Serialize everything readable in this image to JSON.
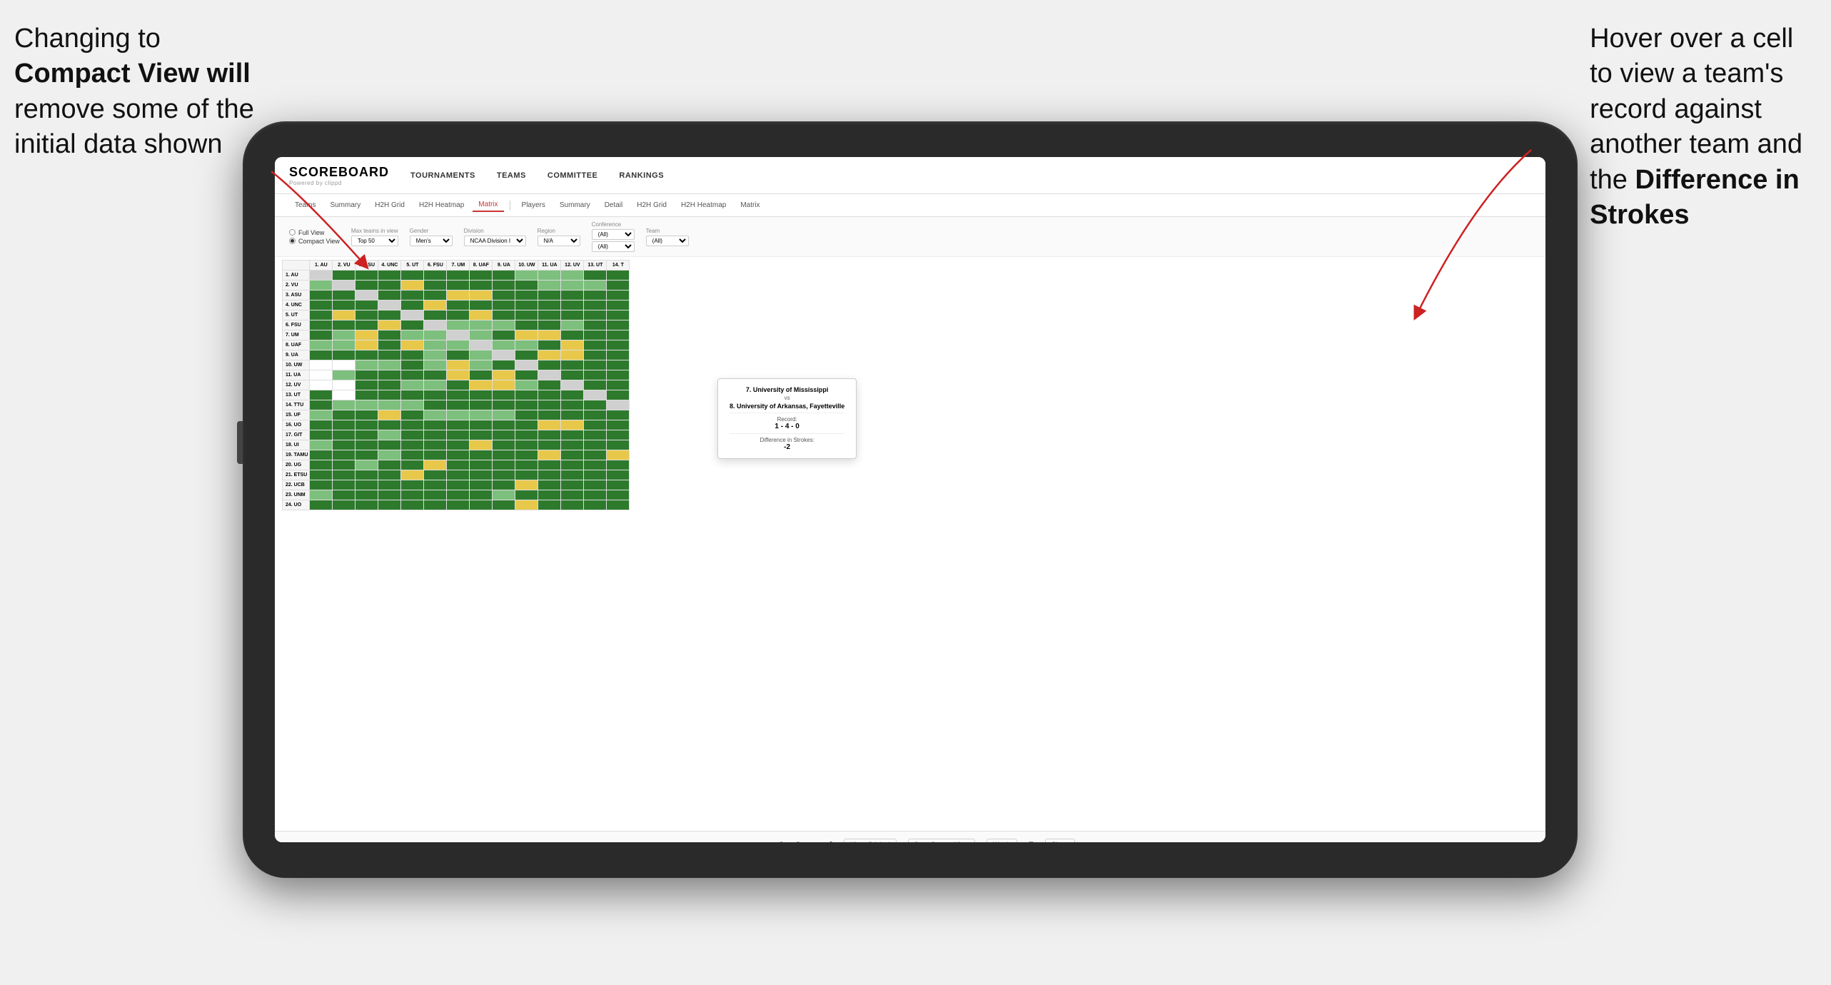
{
  "annotations": {
    "left_text_line1": "Changing to",
    "left_text_line2": "Compact View will",
    "left_text_line3": "remove some of the",
    "left_text_line4": "initial data shown",
    "right_text_line1": "Hover over a cell",
    "right_text_line2": "to view a team's",
    "right_text_line3": "record against",
    "right_text_line4": "another team and",
    "right_text_line5_prefix": "the ",
    "right_text_line5_bold": "Difference in",
    "right_text_line6": "Strokes"
  },
  "app": {
    "logo": "SCOREBOARD",
    "logo_sub": "Powered by clippd",
    "nav_items": [
      "TOURNAMENTS",
      "TEAMS",
      "COMMITTEE",
      "RANKINGS"
    ],
    "sub_nav_left": [
      "Teams",
      "Summary",
      "H2H Grid",
      "H2H Heatmap",
      "Matrix"
    ],
    "sub_nav_right": [
      "Players",
      "Summary",
      "Detail",
      "H2H Grid",
      "H2H Heatmap",
      "Matrix"
    ],
    "active_tab": "Matrix"
  },
  "filters": {
    "view_full": "Full View",
    "view_compact": "Compact View",
    "selected_view": "compact",
    "max_teams_label": "Max teams in view",
    "max_teams_value": "Top 50",
    "gender_label": "Gender",
    "gender_value": "Men's",
    "division_label": "Division",
    "division_value": "NCAA Division I",
    "region_label": "Region",
    "region_value": "N/A",
    "conference_label": "Conference",
    "conference_values": [
      "(All)",
      "(All)"
    ],
    "team_label": "Team",
    "team_value": "(All)"
  },
  "col_headers": [
    "1. AU",
    "2. VU",
    "3. ASU",
    "4. UNC",
    "5. UT",
    "6. FSU",
    "7. UM",
    "8. UAF",
    "9. UA",
    "10. UW",
    "11. UA",
    "12. UV",
    "13. UT",
    "14. T"
  ],
  "row_headers": [
    "1. AU",
    "2. VU",
    "3. ASU",
    "4. UNC",
    "5. UT",
    "6. FSU",
    "7. UM",
    "8. UAF",
    "9. UA",
    "10. UW",
    "11. UA",
    "12. UV",
    "13. UT",
    "14. TTU",
    "15. UF",
    "16. UO",
    "17. GIT",
    "18. UI",
    "19. TAMU",
    "20. UG",
    "21. ETSU",
    "22. UCB",
    "23. UNM",
    "24. UO"
  ],
  "tooltip": {
    "team1": "7. University of Mississippi",
    "vs": "vs",
    "team2": "8. University of Arkansas, Fayetteville",
    "record_label": "Record:",
    "record_value": "1 - 4 - 0",
    "strokes_label": "Difference in Strokes:",
    "strokes_value": "-2"
  },
  "toolbar": {
    "undo": "↩",
    "redo": "↪",
    "tools": [
      "⊖",
      "⊕",
      "÷",
      "↺"
    ],
    "view_original": "View: Original",
    "save_custom": "Save Custom View",
    "watch": "Watch",
    "layout": "⊞",
    "share": "Share"
  }
}
